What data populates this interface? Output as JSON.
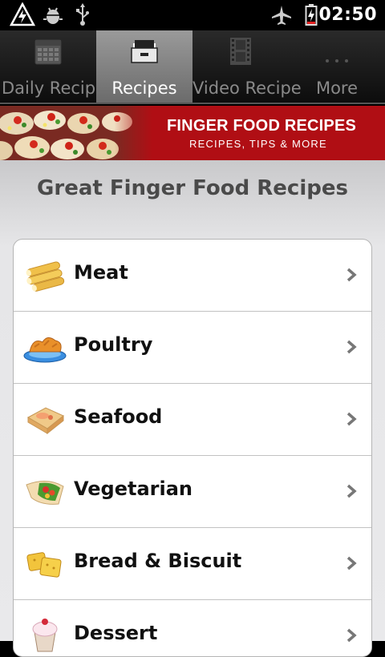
{
  "status_bar": {
    "time": "02:50",
    "icons": [
      "warning-icon",
      "android-debug-icon",
      "usb-icon",
      "airplane-mode-icon",
      "battery-charging-icon"
    ]
  },
  "tabs": [
    {
      "label": "Daily Recipes",
      "icon": "calendar-icon",
      "active": false
    },
    {
      "label": "Recipes",
      "icon": "recipe-box-icon",
      "active": true
    },
    {
      "label": "Video Recipe",
      "icon": "film-icon",
      "active": false
    },
    {
      "label": "More",
      "icon": "more-icon",
      "active": false
    }
  ],
  "banner": {
    "title": "FINGER FOOD RECIPES",
    "subtitle": "RECIPES, TIPS & MORE"
  },
  "page": {
    "title": "Great Finger Food Recipes"
  },
  "categories": [
    {
      "label": "Meat",
      "icon": "meat-rolls-icon"
    },
    {
      "label": "Poultry",
      "icon": "poultry-plate-icon"
    },
    {
      "label": "Seafood",
      "icon": "seafood-icon"
    },
    {
      "label": "Vegetarian",
      "icon": "vegetarian-wrap-icon"
    },
    {
      "label": "Bread & Biscuit",
      "icon": "bread-icon"
    },
    {
      "label": "Dessert",
      "icon": "dessert-icon"
    }
  ],
  "colors": {
    "banner_red": "#b00e14",
    "active_tab": "#8a8a8a"
  }
}
